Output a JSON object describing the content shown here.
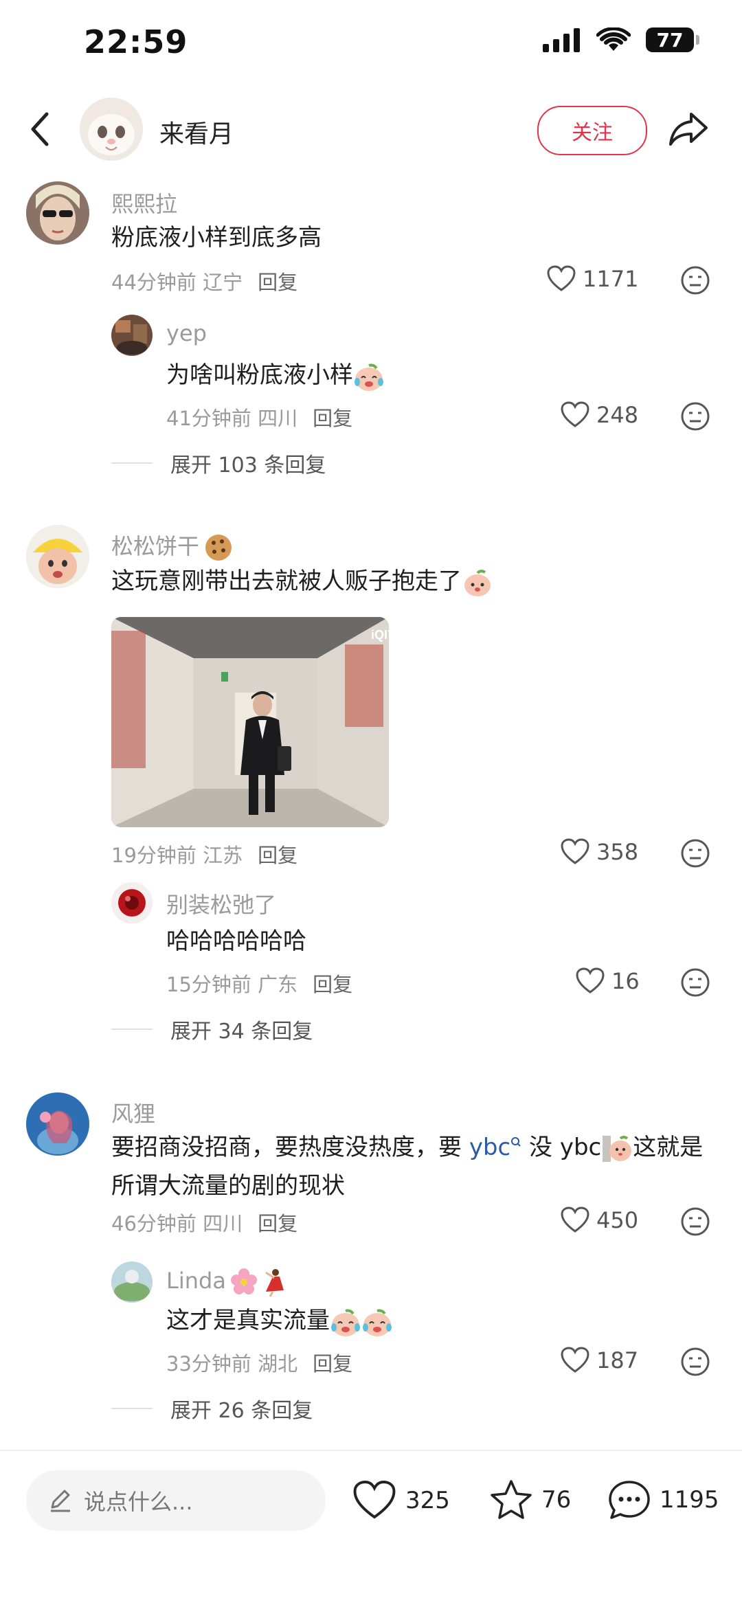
{
  "status": {
    "time": "22:59",
    "battery": "77"
  },
  "header": {
    "name": "来看月",
    "follow": "关注"
  },
  "comments": [
    {
      "user": "熙熙拉",
      "text": "粉底液小样到底多高",
      "time": "44分钟前 辽宁",
      "reply": "回复",
      "likes": "1171",
      "sub": {
        "user": "yep",
        "text": "为啥叫粉底液小样",
        "time": "41分钟前 四川",
        "reply": "回复",
        "likes": "248"
      },
      "expand": "展开 103 条回复"
    },
    {
      "user": "松松饼干",
      "text": "这玩意刚带出去就被人贩子抱走了",
      "time": "19分钟前 江苏",
      "reply": "回复",
      "likes": "358",
      "image_watermark": "iQIY",
      "sub": {
        "user": "别装松弛了",
        "text": "哈哈哈哈哈哈",
        "time": "15分钟前 广东",
        "reply": "回复",
        "likes": "16"
      },
      "expand": "展开 34 条回复"
    },
    {
      "user": "风狸",
      "text_a": "要招商没招商，要热度没热度，要 ",
      "link": "ybc",
      "text_b": " 没 ybc",
      "text_c": "这就是",
      "text_d": "所谓大流量的剧的现状",
      "time": "46分钟前 四川",
      "reply": "回复",
      "likes": "450",
      "sub": {
        "user": "Linda",
        "text": "这才是真实流量",
        "time": "33分钟前 湖北",
        "reply": "回复",
        "likes": "187"
      },
      "expand": "展开 26 条回复"
    }
  ],
  "bottom": {
    "placeholder": "说点什么...",
    "likes": "325",
    "stars": "76",
    "comments": "1195"
  },
  "colors": {
    "accent": "#e0344a",
    "link": "#2b5aa8",
    "meta": "#9a9a9a"
  }
}
